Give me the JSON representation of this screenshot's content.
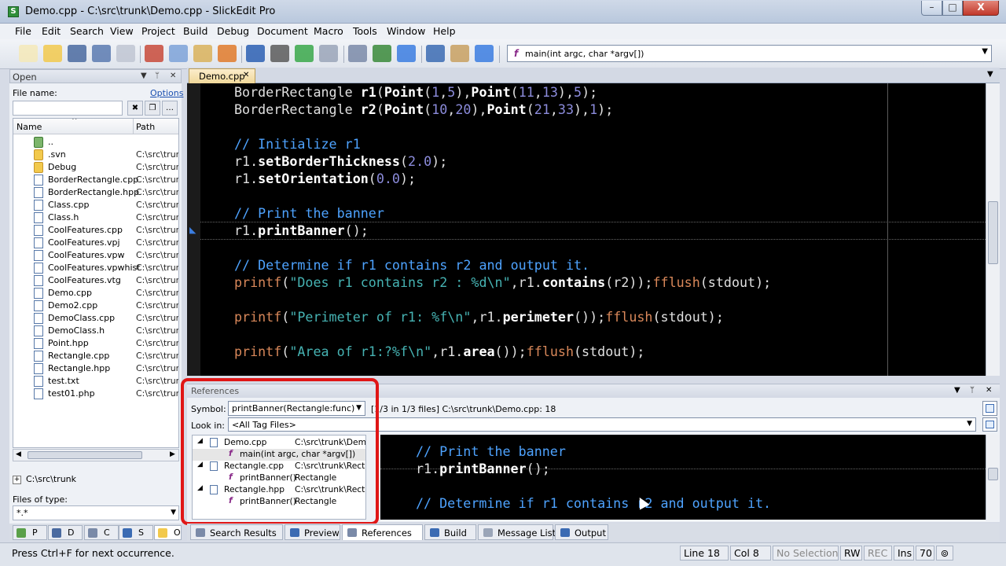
{
  "window": {
    "title": "Demo.cpp - C:\\src\\trunk\\Demo.cpp - SlickEdit Pro",
    "min_label": "–",
    "max_label": "□",
    "close_label": "X"
  },
  "menu": [
    "File",
    "Edit",
    "Search",
    "View",
    "Project",
    "Build",
    "Debug",
    "Document",
    "Macro",
    "Tools",
    "Window",
    "Help"
  ],
  "toolbar": {
    "icons": [
      "new-file-icon",
      "open-folder-icon",
      "save-icon",
      "save-all-icon",
      "print-icon",
      "cut-icon",
      "copy-icon",
      "paste-icon",
      "select-icon",
      "undo-icon",
      "redo-icon",
      "back-icon",
      "forward-icon",
      "debug-icon",
      "step-icon",
      "build-icon",
      "monitor-icon",
      "tools-icon",
      "help-icon"
    ],
    "function_combo": "main(int argc, char *argv[])",
    "function_icon": "f"
  },
  "open_panel": {
    "title": "Open",
    "file_name_label": "File name:",
    "options_link": "Options",
    "column_name": "Name",
    "column_path": "Path",
    "files": [
      {
        "name": "..",
        "path": "",
        "type": "up"
      },
      {
        "name": ".svn",
        "path": "C:\\src\\trunk",
        "type": "folder"
      },
      {
        "name": "Debug",
        "path": "C:\\src\\trunk",
        "type": "folder"
      },
      {
        "name": "BorderRectangle.cpp",
        "path": "C:\\src\\trunk",
        "type": "doc"
      },
      {
        "name": "BorderRectangle.hpp",
        "path": "C:\\src\\trunk",
        "type": "doc"
      },
      {
        "name": "Class.cpp",
        "path": "C:\\src\\trunk",
        "type": "doc"
      },
      {
        "name": "Class.h",
        "path": "C:\\src\\trunk",
        "type": "doc"
      },
      {
        "name": "CoolFeatures.cpp",
        "path": "C:\\src\\trunk",
        "type": "doc"
      },
      {
        "name": "CoolFeatures.vpj",
        "path": "C:\\src\\trunk",
        "type": "doc"
      },
      {
        "name": "CoolFeatures.vpw",
        "path": "C:\\src\\trunk",
        "type": "doc"
      },
      {
        "name": "CoolFeatures.vpwhist",
        "path": "C:\\src\\trunk",
        "type": "doc"
      },
      {
        "name": "CoolFeatures.vtg",
        "path": "C:\\src\\trunk",
        "type": "doc"
      },
      {
        "name": "Demo.cpp",
        "path": "C:\\src\\trunk",
        "type": "doc"
      },
      {
        "name": "Demo2.cpp",
        "path": "C:\\src\\trunk",
        "type": "doc"
      },
      {
        "name": "DemoClass.cpp",
        "path": "C:\\src\\trunk",
        "type": "doc"
      },
      {
        "name": "DemoClass.h",
        "path": "C:\\src\\trunk",
        "type": "doc"
      },
      {
        "name": "Point.hpp",
        "path": "C:\\src\\trunk",
        "type": "doc"
      },
      {
        "name": "Rectangle.cpp",
        "path": "C:\\src\\trunk",
        "type": "doc"
      },
      {
        "name": "Rectangle.hpp",
        "path": "C:\\src\\trunk",
        "type": "doc"
      },
      {
        "name": "test.txt",
        "path": "C:\\src\\trunk",
        "type": "doc"
      },
      {
        "name": "test01.php",
        "path": "C:\\src\\trunk",
        "type": "doc"
      }
    ],
    "directory": "C:\\src\\trunk",
    "files_of_type_label": "Files of type:",
    "files_of_type_value": "*.*",
    "tabs": [
      "P",
      "D",
      "C",
      "S",
      "O"
    ]
  },
  "editor": {
    "tab": "Demo.cpp",
    "tab_close": "✕",
    "lines": [
      {
        "segs": [
          [
            "",
            "BorderRectangle "
          ],
          [
            "kw-b",
            "r1"
          ],
          [
            "",
            "("
          ],
          [
            "kw-b",
            "Point"
          ],
          [
            "",
            "("
          ],
          [
            "num",
            "1"
          ],
          [
            "",
            ","
          ],
          [
            "num",
            "5"
          ],
          [
            "",
            "),"
          ],
          [
            "kw-b",
            "Point"
          ],
          [
            "",
            "("
          ],
          [
            "num",
            "11"
          ],
          [
            "",
            ","
          ],
          [
            "num",
            "13"
          ],
          [
            "",
            "),"
          ],
          [
            "num",
            "5"
          ],
          [
            "",
            ");"
          ]
        ]
      },
      {
        "segs": [
          [
            "",
            "BorderRectangle "
          ],
          [
            "kw-b",
            "r2"
          ],
          [
            "",
            "("
          ],
          [
            "kw-b",
            "Point"
          ],
          [
            "",
            "("
          ],
          [
            "num",
            "10"
          ],
          [
            "",
            ","
          ],
          [
            "num",
            "20"
          ],
          [
            "",
            "),"
          ],
          [
            "kw-b",
            "Point"
          ],
          [
            "",
            "("
          ],
          [
            "num",
            "21"
          ],
          [
            "",
            ","
          ],
          [
            "num",
            "33"
          ],
          [
            "",
            "),"
          ],
          [
            "num",
            "1"
          ],
          [
            "",
            ");"
          ]
        ]
      },
      {
        "segs": []
      },
      {
        "segs": [
          [
            "cmt",
            "// Initialize r1"
          ]
        ]
      },
      {
        "segs": [
          [
            "",
            "r1."
          ],
          [
            "kw-b",
            "setBorderThickness"
          ],
          [
            "",
            "("
          ],
          [
            "num",
            "2.0"
          ],
          [
            "",
            ");"
          ]
        ]
      },
      {
        "segs": [
          [
            "",
            "r1."
          ],
          [
            "kw-b",
            "setOrientation"
          ],
          [
            "",
            "("
          ],
          [
            "num",
            "0.0"
          ],
          [
            "",
            ");"
          ]
        ]
      },
      {
        "segs": []
      },
      {
        "segs": [
          [
            "cmt",
            "// Print the banner"
          ]
        ]
      },
      {
        "segs": [
          [
            "",
            "r1."
          ],
          [
            "kw-b",
            "printBanner"
          ],
          [
            "",
            "();"
          ]
        ]
      },
      {
        "segs": []
      },
      {
        "segs": [
          [
            "cmt",
            "// Determine if r1 contains r2 and output it."
          ]
        ]
      },
      {
        "segs": [
          [
            "fnc",
            "printf"
          ],
          [
            "",
            "("
          ],
          [
            "str",
            "\"Does r1 contains r2 : %d\\n\""
          ],
          [
            "",
            ",r1."
          ],
          [
            "kw-b",
            "contains"
          ],
          [
            "",
            "(r2));"
          ],
          [
            "fnc",
            "fflush"
          ],
          [
            "",
            "(stdout);"
          ]
        ]
      },
      {
        "segs": []
      },
      {
        "segs": [
          [
            "fnc",
            "printf"
          ],
          [
            "",
            "("
          ],
          [
            "str",
            "\"Perimeter of r1: %f\\n\""
          ],
          [
            "",
            ",r1."
          ],
          [
            "kw-b",
            "perimeter"
          ],
          [
            "",
            "());"
          ],
          [
            "fnc",
            "fflush"
          ],
          [
            "",
            "(stdout);"
          ]
        ]
      },
      {
        "segs": []
      },
      {
        "segs": [
          [
            "fnc",
            "printf"
          ],
          [
            "",
            "("
          ],
          [
            "str",
            "\"Area of r1:?%f\\n\""
          ],
          [
            "",
            ",r1."
          ],
          [
            "kw-b",
            "area"
          ],
          [
            "",
            "());"
          ],
          [
            "fnc",
            "fflush"
          ],
          [
            "",
            "(stdout);"
          ]
        ]
      }
    ]
  },
  "references": {
    "title": "References",
    "symbol_label": "Symbol:",
    "symbol_value": "printBanner(Rectangle:func)",
    "status": "[1/3 in 1/3 files] C:\\src\\trunk\\Demo.cpp: 18",
    "lookin_label": "Look in:",
    "lookin_value": "<All Tag Files>",
    "tree": [
      {
        "level": 0,
        "name": "Demo.cpp",
        "path": "C:\\src\\trunk\\Demo"
      },
      {
        "level": 1,
        "name": "main(int argc, char *argv[])",
        "path": "",
        "selected": true
      },
      {
        "level": 0,
        "name": "Rectangle.cpp",
        "path": "C:\\src\\trunk\\Recta"
      },
      {
        "level": 1,
        "name": "printBanner()",
        "path": "Rectangle"
      },
      {
        "level": 0,
        "name": "Rectangle.hpp",
        "path": "C:\\src\\trunk\\Recta"
      },
      {
        "level": 1,
        "name": "printBanner()",
        "path": "Rectangle"
      }
    ],
    "preview_lines": [
      {
        "segs": []
      },
      {
        "segs": [
          [
            "cmt",
            "// Print the banner"
          ]
        ]
      },
      {
        "segs": [
          [
            "",
            "r1."
          ],
          [
            "kw-b",
            "printBanner"
          ],
          [
            "",
            "();"
          ]
        ]
      },
      {
        "segs": []
      },
      {
        "segs": [
          [
            "cmt",
            "// Determine if r1 contains r2 and output it."
          ]
        ]
      }
    ]
  },
  "bottom_tabs": [
    "Search Results",
    "Preview",
    "References",
    "Build",
    "Message List",
    "Output"
  ],
  "status_bar": {
    "message": "Press Ctrl+F for next occurrence.",
    "line": "Line 18",
    "col": "Col 8",
    "selection": "No Selection",
    "rw": "RW",
    "rec": "REC",
    "ins": "Ins",
    "num": "70"
  },
  "colors": {
    "accent_red": "#e01616",
    "editor_bg": "#000000",
    "comment": "#4ea3ff",
    "string": "#46b3b3"
  }
}
